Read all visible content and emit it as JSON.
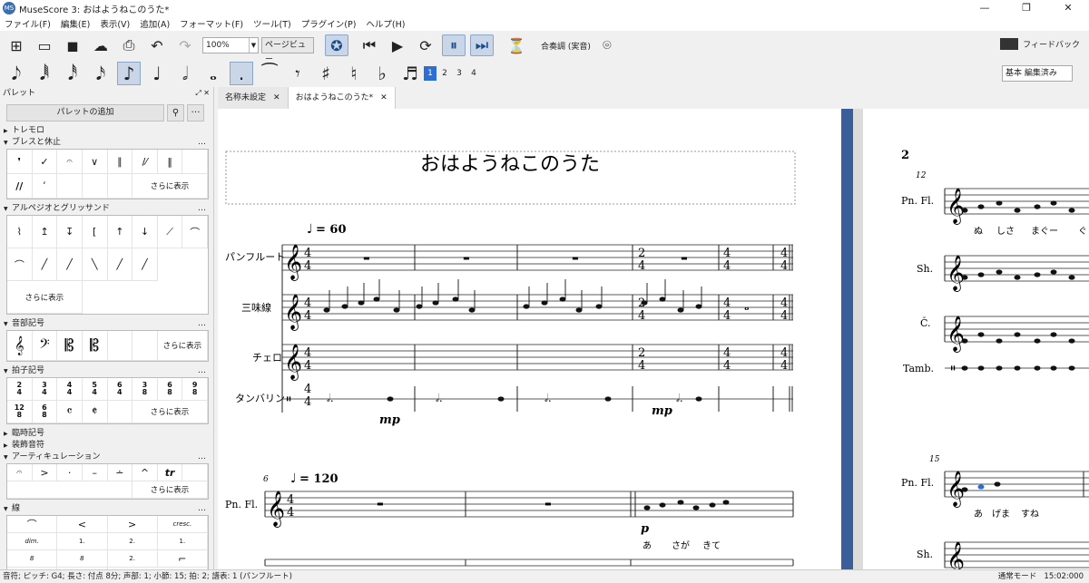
{
  "window": {
    "title": "MuseScore 3: おはようねこのうた*",
    "app_icon": "MS"
  },
  "menu": [
    "ファイル(F)",
    "編集(E)",
    "表示(V)",
    "追加(A)",
    "フォーマット(F)",
    "ツール(T)",
    "プラグイン(P)",
    "ヘルプ(H)"
  ],
  "toolbar": {
    "zoom": "100%",
    "view_mode": "ページビュー",
    "concert_pitch": "合奏調 (実音)",
    "feedback": "フィードバック"
  },
  "note_toolbar": {
    "voices": [
      "1",
      "2",
      "3",
      "4"
    ],
    "workspace": "基本 編集済み"
  },
  "palette": {
    "header": "パレット",
    "add_button": "パレットの追加",
    "more_label": "さらに表示",
    "sections": {
      "tremolo": "トレモロ",
      "breath": "ブレスと休止",
      "arpeggio": "アルペジオとグリッサンド",
      "clefs": "音部記号",
      "time_sig": "拍子記号",
      "accidentals": "臨時記号",
      "grace": "装飾音符",
      "articulations": "アーティキュレーション",
      "lines": "線"
    },
    "lines_cells": [
      "cresc.",
      "dim.",
      "1.",
      "2.",
      "1.",
      "2.",
      "8",
      "8",
      "8"
    ]
  },
  "tabs": [
    {
      "label": "名称未設定"
    },
    {
      "label": "おはようねこのうた*"
    }
  ],
  "score": {
    "title": "おはようねこのうた",
    "system1": {
      "tempo": "= 60",
      "instruments": [
        "パンフルート",
        "三味線",
        "チェロ",
        "タンバリン"
      ],
      "dynamics": [
        "mp",
        "mp"
      ]
    },
    "system2": {
      "measure_number": "6",
      "tempo": "= 120",
      "instrument": "Pn. Fl.",
      "dynamic": "p",
      "lyrics": [
        "あ",
        "さが",
        "きて"
      ]
    },
    "page2": {
      "page_number": "2",
      "measure_number_1": "12",
      "instruments": [
        "Pn. Fl.",
        "Sh.",
        "Č.",
        "Tamb."
      ],
      "lyrics": [
        "ぬ",
        "しさ",
        "まぐー",
        "ぐ"
      ],
      "measure_number_2": "15",
      "instruments_2": [
        "Pn. Fl.",
        "Sh."
      ],
      "lyrics_2": [
        "あ",
        "げま",
        "すね"
      ]
    }
  },
  "status": {
    "left": "音符; ピッチ: G4; 長さ: 付点 8分; 声部: 1; 小節: 15; 拍: 2; 譜表: 1 (パンフルート)",
    "mode": "通常モード",
    "time": "15:02:000"
  }
}
